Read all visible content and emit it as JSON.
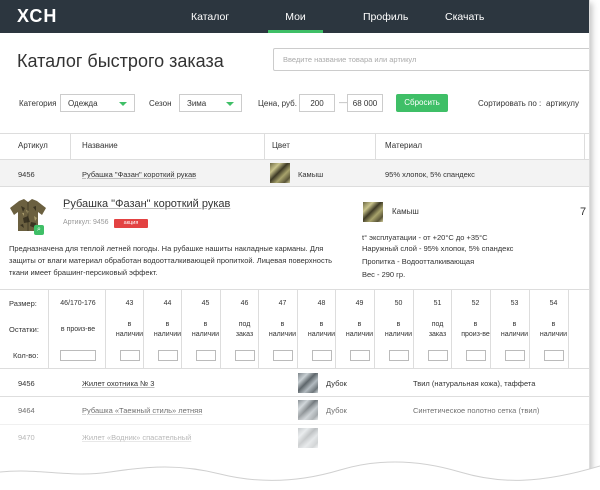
{
  "brand": {
    "logo": "ХСН"
  },
  "nav": {
    "items": [
      "Каталог",
      "Мои заказы",
      "Профиль",
      "Скачать"
    ],
    "active": "Мои заказы"
  },
  "page": {
    "title": "Каталог быстрого заказа"
  },
  "search": {
    "placeholder": "Введите название товара или артикул"
  },
  "filters": {
    "category_label": "Категория",
    "category_value": "Одежда",
    "season_label": "Сезон",
    "season_value": "Зима",
    "price_label": "Цена, руб.",
    "price_from": "200",
    "price_dash": "—",
    "price_to": "68 000",
    "reset_label": "Сбросить",
    "sort_label": "Сортировать по :",
    "sort_value": "артикулу"
  },
  "table": {
    "headers": [
      "Артикул",
      "Название",
      "Цвет",
      "Материал"
    ],
    "rows": [
      {
        "article": "9456",
        "name": "Рубашка \"Фазан\" короткий рукав",
        "color": "Камыш",
        "material": "95% хлопок, 5% спандекс"
      },
      {
        "article": "9456",
        "name": "Жилет охотника № 3",
        "color": "Дубок",
        "material": "Твил (натуральная кожа), таффета"
      },
      {
        "article": "9464",
        "name": "Рубашка «Таежный стиль» летняя",
        "color": "Дубок",
        "material": "Синтетическое полотно сетка (твил)"
      },
      {
        "article": "9470",
        "name": "Жилет «Водник» спасательный",
        "color": "",
        "material": ""
      }
    ]
  },
  "detail": {
    "title": "Рубашка \"Фазан\" короткий рукав",
    "article": "Артикул: 9456",
    "badge": "акция",
    "description": "Предназначена для теплой летней погоды. На рубашке нашиты накладные карманы. Для защиты от влаги материал обработан водоотталкивающей пропиткой. Лицевая поверхность ткани имеет брашинг-персиковый эффект.",
    "color": "Камыш",
    "specs": [
      "t° эксплуатации - от +20°С до +35°С",
      "Наружный слой - 95% хлопок, 5% спандекс",
      "Пропитка - Водоотталкивающая",
      "Вес - 290 гр."
    ],
    "edge_digit": "7"
  },
  "sizes": {
    "size_label": "Размер:",
    "stock_label": "Остатки:",
    "qty_label": "Кол-во:",
    "values": [
      "46/170-176",
      "43",
      "44",
      "45",
      "46",
      "47",
      "48",
      "49",
      "50",
      "51",
      "52",
      "53",
      "54"
    ],
    "stock": [
      [
        "в произ-ве"
      ],
      [
        "в",
        "наличии"
      ],
      [
        "в",
        "наличии"
      ],
      [
        "в",
        "наличии"
      ],
      [
        "под",
        "заказ"
      ],
      [
        "в",
        "наличии"
      ],
      [
        "в",
        "наличии"
      ],
      [
        "в",
        "наличии"
      ],
      [
        "в",
        "наличии"
      ],
      [
        "под",
        "заказ"
      ],
      [
        "в",
        "произ-ве"
      ],
      [
        "в",
        "наличии"
      ],
      [
        "в",
        "наличии"
      ]
    ]
  },
  "colors": {
    "accent": "#3fbf67",
    "nav_bg": "#2c363f",
    "badge": "#e34242"
  }
}
